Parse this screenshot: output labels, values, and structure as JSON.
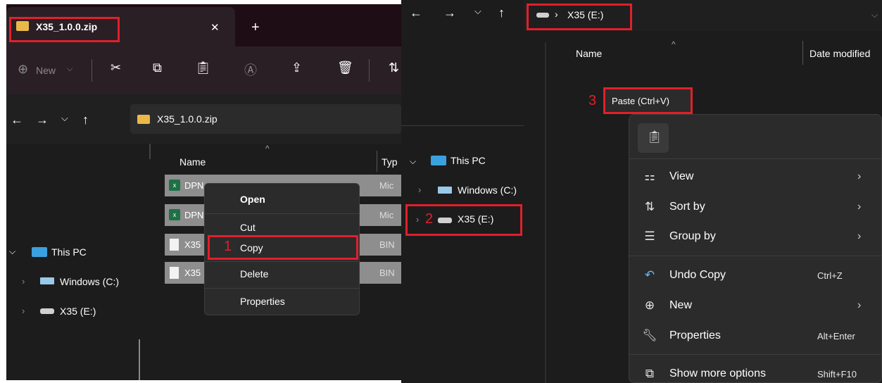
{
  "left_window": {
    "tab_title": "X35_1.0.0.zip",
    "tab_close": "✕",
    "tab_new": "+",
    "toolbar": {
      "new_label": "New"
    },
    "address": "X35_1.0.0.zip",
    "column_name": "Name",
    "column_type": "Typ",
    "files": [
      {
        "name": "DPN",
        "type": "Mic"
      },
      {
        "name": "DPN",
        "type": "Mic"
      },
      {
        "name": "X35",
        "type": "BIN"
      },
      {
        "name": "X35",
        "type": "BIN"
      }
    ],
    "nav": {
      "this_pc": "This PC",
      "windows": "Windows (C:)",
      "x35": "X35 (E:)"
    },
    "context_menu": {
      "open": "Open",
      "cut": "Cut",
      "copy": "Copy",
      "delete": "Delete",
      "properties": "Properties"
    },
    "step_number": "1"
  },
  "middle_window": {
    "nav": {
      "this_pc": "This PC",
      "windows": "Windows (C:)",
      "x35": "X35 (E:)"
    },
    "step_number": "2"
  },
  "right_window": {
    "address": "X35 (E:)",
    "column_name": "Name",
    "column_date": "Date modified",
    "paste_tooltip": "Paste (Ctrl+V)",
    "step_number": "3",
    "menu": [
      {
        "icon": "view-icon",
        "label": "View",
        "shortcut": "",
        "submenu": true
      },
      {
        "icon": "sort-icon",
        "label": "Sort by",
        "shortcut": "",
        "submenu": true
      },
      {
        "icon": "group-icon",
        "label": "Group by",
        "shortcut": "",
        "submenu": true
      },
      {
        "icon": "undo-icon",
        "label": "Undo Copy",
        "shortcut": "Ctrl+Z",
        "submenu": false
      },
      {
        "icon": "new-icon",
        "label": "New",
        "shortcut": "",
        "submenu": true
      },
      {
        "icon": "wrench-icon",
        "label": "Properties",
        "shortcut": "Alt+Enter",
        "submenu": false
      },
      {
        "icon": "more-options-icon",
        "label": "Show more options",
        "shortcut": "Shift+F10",
        "submenu": false
      }
    ]
  },
  "colors": {
    "highlight": "#e0202b",
    "window_bg": "#1c1c1c",
    "menu_bg": "#2b2b2b"
  }
}
